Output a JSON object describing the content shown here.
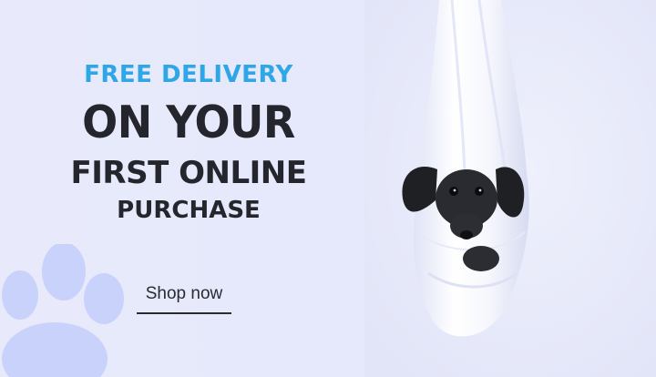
{
  "promo": {
    "kicker": "FREE DELIVERY",
    "headline": "ON YOUR",
    "subline1": "FIRST ONLINE",
    "subline2": "PURCHASE",
    "cta_label": "Shop now"
  },
  "colors": {
    "background": "#e8eafb",
    "kicker": "#2fa6e6",
    "headline": "#25262d",
    "paw": "#c9d2fb"
  },
  "icons": {
    "decor": "paw-print-icon",
    "image": "dachshund-in-sling-image"
  }
}
